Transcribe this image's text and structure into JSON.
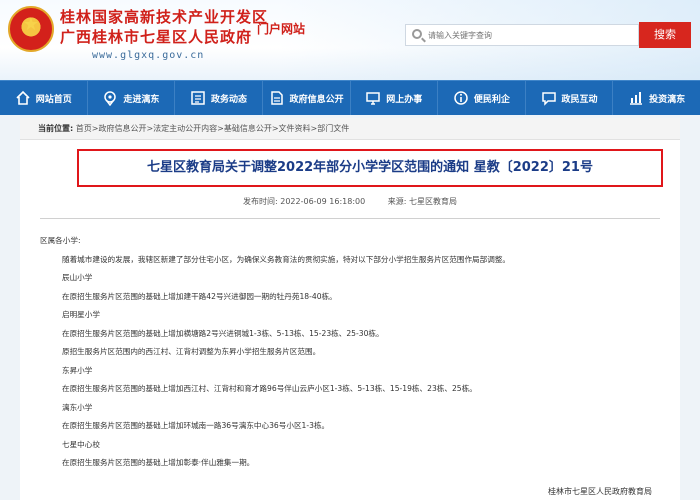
{
  "header": {
    "site_name_line1": "桂林国家高新技术产业开发区",
    "site_name_line2": "广西桂林市七星区人民政府",
    "portal_label": "门户网站",
    "url": "www.glgxq.gov.cn",
    "search_placeholder": "请输入关键字查询",
    "search_button": "搜索"
  },
  "nav": {
    "items": [
      {
        "label": "网站首页",
        "icon": "home-icon"
      },
      {
        "label": "走进漓东",
        "icon": "location-icon"
      },
      {
        "label": "政务动态",
        "icon": "news-icon"
      },
      {
        "label": "政府信息公开",
        "icon": "document-icon"
      },
      {
        "label": "网上办事",
        "icon": "monitor-icon"
      },
      {
        "label": "便民利企",
        "icon": "info-icon"
      },
      {
        "label": "政民互动",
        "icon": "chat-icon"
      },
      {
        "label": "投资漓东",
        "icon": "chart-icon"
      }
    ]
  },
  "breadcrumb": {
    "label": "当前位置:",
    "path": "首页>政府信息公开>法定主动公开内容>基础信息公开>文件资料>部门文件"
  },
  "article": {
    "title": "七星区教育局关于调整2022年部分小学学区范围的通知 星教〔2022〕21号",
    "publish_time": "发布时间: 2022-06-09 16:18:00",
    "source": "来源: 七星区教育局",
    "paragraphs": [
      {
        "text": "区属各小学:",
        "indent": false
      },
      {
        "text": "随着城市建设的发展，我辖区新建了部分住宅小区，为确保义务教育法的贯彻实施，特对以下部分小学招生服务片区范围作局部调整。",
        "indent": true
      },
      {
        "text": "辰山小学",
        "indent": true
      },
      {
        "text": "在原招生服务片区范围的基础上增加建干路42号兴进御园一期的牡丹苑18-40栋。",
        "indent": true
      },
      {
        "text": "启明星小学",
        "indent": true
      },
      {
        "text": "在原招生服务片区范围的基础上增加横塘路2号兴进铜城1-3栋、5-13栋、15-23栋、25-30栋。",
        "indent": true
      },
      {
        "text": "原招生服务片区范围内的西江村、江背村调整为东昇小学招生服务片区范围。",
        "indent": true
      },
      {
        "text": "东昇小学",
        "indent": true
      },
      {
        "text": "在原招生服务片区范围的基础上增加西江村、江背村和育才路96号伴山云庐小区1-3栋、5-13栋、15-19栋、23栋、25栋。",
        "indent": true
      },
      {
        "text": "漓东小学",
        "indent": true
      },
      {
        "text": "在原招生服务片区范围的基础上增加环城南一路36号漓东中心36号小区1-3栋。",
        "indent": true
      },
      {
        "text": "七星中心校",
        "indent": true
      },
      {
        "text": "在原招生服务片区范围的基础上增加彰泰·伴山雅集一期。",
        "indent": true
      }
    ],
    "signoff": "桂林市七星区人民政府教育局"
  },
  "colors": {
    "nav_bg": "#1c69b6",
    "brand_red": "#d0211b",
    "title_blue": "#1b3c87",
    "title_border": "#e0161a"
  }
}
